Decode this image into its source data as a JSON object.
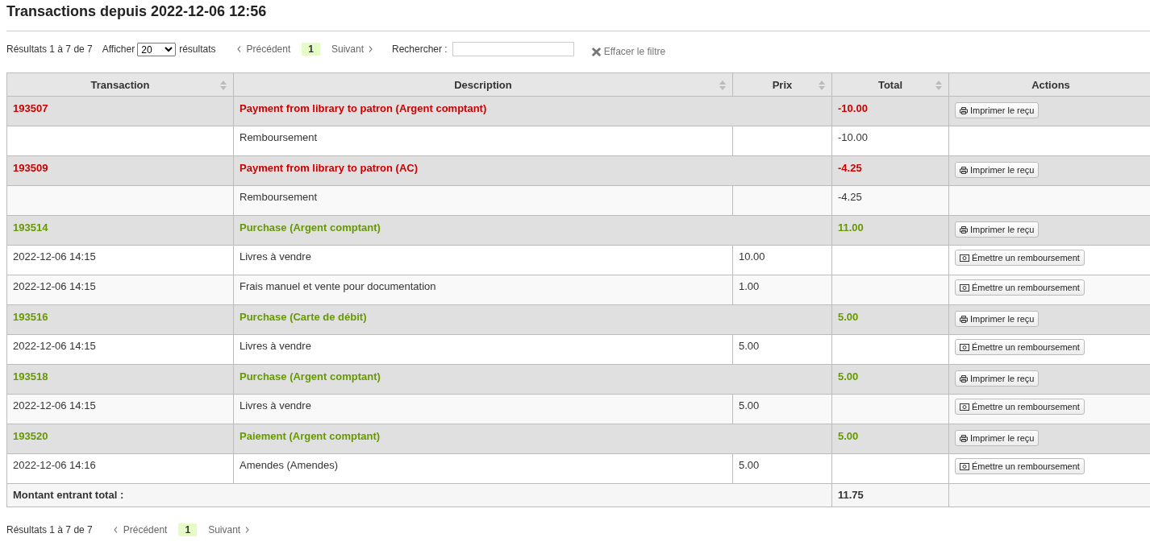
{
  "title": "Transactions depuis 2022-12-06 12:56",
  "pager_top": {
    "summary": "Résultats 1 à 7 de 7",
    "show_label": "Afficher",
    "page_size": "20",
    "show_suffix": "résultats",
    "previous": "Précédent",
    "pages": [
      {
        "label": "1",
        "selected": true
      }
    ],
    "next": "Suivant",
    "search_label": "Rechercher :",
    "clear_filter": "Effacer le filtre"
  },
  "table": {
    "columns": [
      {
        "label": "Transaction",
        "sortable": true
      },
      {
        "label": "Description",
        "sortable": true
      },
      {
        "label": "Prix",
        "sortable": true
      },
      {
        "label": "Total",
        "sortable": true
      },
      {
        "label": "Actions",
        "sortable": false
      }
    ],
    "rows": [
      {
        "kind": "transaction",
        "id": "193507",
        "description": "Payment from library to patron (Argent comptant)",
        "total": "-10.00",
        "color": "#cc0000",
        "action": "Imprimer le reçu"
      },
      {
        "kind": "line",
        "description": "Remboursement",
        "total": "-10.00"
      },
      {
        "kind": "transaction",
        "id": "193509",
        "description": "Payment from library to patron (AC)",
        "total": "-4.25",
        "color": "#cc0000",
        "action": "Imprimer le reçu"
      },
      {
        "kind": "line",
        "description": "Remboursement",
        "total": "-4.25"
      },
      {
        "kind": "transaction",
        "id": "193514",
        "description": "Purchase (Argent comptant)",
        "total": "11.00",
        "color": "#669900",
        "action": "Imprimer le reçu"
      },
      {
        "kind": "line",
        "date": "2022-12-06 14:15",
        "description": "Livres à vendre",
        "price": "10.00",
        "action": "Émettre un remboursement"
      },
      {
        "kind": "line",
        "date": "2022-12-06 14:15",
        "description": "Frais manuel et vente pour documentation",
        "price": "1.00",
        "action": "Émettre un remboursement"
      },
      {
        "kind": "transaction",
        "id": "193516",
        "description": "Purchase (Carte de débit)",
        "total": "5.00",
        "color": "#669900",
        "action": "Imprimer le reçu"
      },
      {
        "kind": "line",
        "date": "2022-12-06 14:15",
        "description": "Livres à vendre",
        "price": "5.00",
        "action": "Émettre un remboursement"
      },
      {
        "kind": "transaction",
        "id": "193518",
        "description": "Purchase (Argent comptant)",
        "total": "5.00",
        "color": "#669900",
        "action": "Imprimer le reçu"
      },
      {
        "kind": "line",
        "date": "2022-12-06 14:15",
        "description": "Livres à vendre",
        "price": "5.00",
        "action": "Émettre un remboursement"
      },
      {
        "kind": "transaction",
        "id": "193520",
        "description": "Paiement (Argent comptant)",
        "total": "5.00",
        "color": "#669900",
        "action": "Imprimer le reçu"
      },
      {
        "kind": "line",
        "date": "2022-12-06 14:16",
        "description": "Amendes (Amendes)",
        "price": "5.00",
        "action": "Émettre un remboursement"
      }
    ],
    "footer": {
      "label": "Montant entrant total :",
      "total": "11.75"
    }
  },
  "pager_bottom": {
    "summary": "Résultats 1 à 7 de 7",
    "previous": "Précédent",
    "pages": [
      {
        "label": "1",
        "selected": true
      }
    ],
    "next": "Suivant"
  }
}
